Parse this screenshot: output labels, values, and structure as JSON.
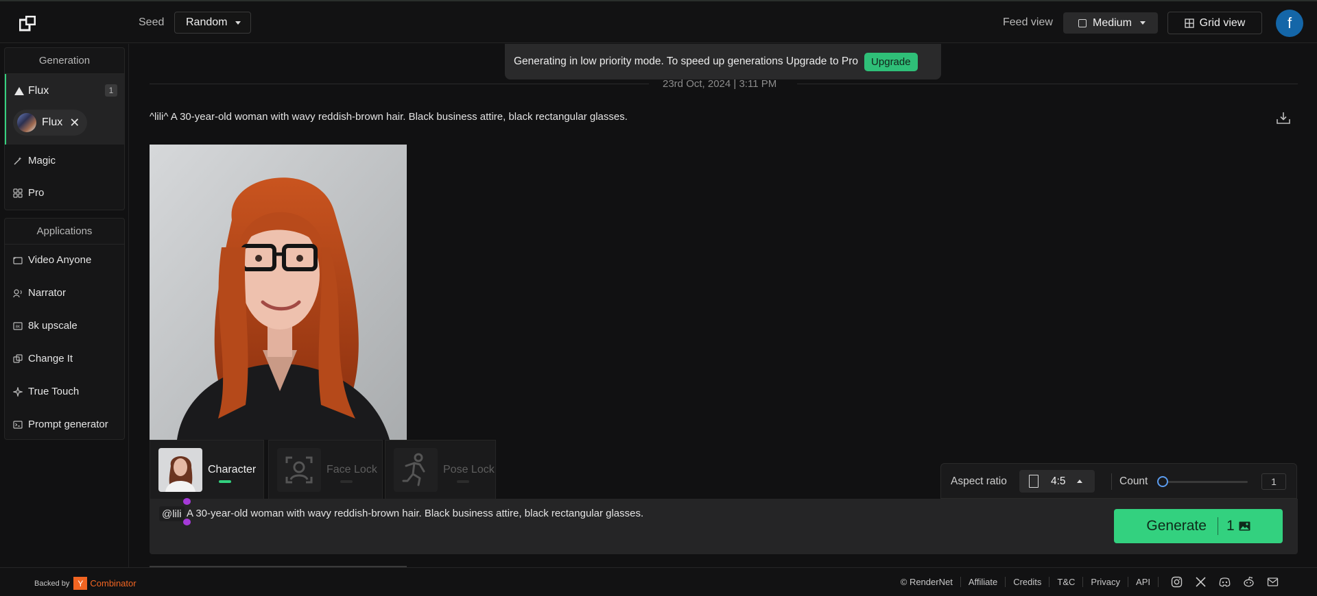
{
  "topbar": {
    "seed_label": "Seed",
    "seed_value": "Random",
    "feed_label": "Feed view",
    "feed_value": "Medium",
    "grid_label": "Grid view",
    "avatar_letter": "f"
  },
  "sidebar": {
    "generation_title": "Generation",
    "flux_label": "Flux",
    "flux_badge": "1",
    "flux_chip_label": "Flux",
    "magic_label": "Magic",
    "pro_label": "Pro",
    "applications_title": "Applications",
    "apps": [
      {
        "label": "Video Anyone",
        "icon": "video-icon"
      },
      {
        "label": "Narrator",
        "icon": "narrator-icon"
      },
      {
        "label": "8k upscale",
        "icon": "upscale-icon"
      },
      {
        "label": "Change It",
        "icon": "change-icon"
      },
      {
        "label": "True Touch",
        "icon": "sparkle-icon"
      },
      {
        "label": "Prompt generator",
        "icon": "terminal-icon"
      }
    ]
  },
  "banner": {
    "message": "Generating in low priority mode. To speed up generations Upgrade to Pro",
    "upgrade_label": "Upgrade"
  },
  "feed": {
    "date": "23rd Oct, 2024 | 3:11 PM",
    "prompt": "^lili^ A 30-year-old woman with wavy reddish-brown hair. Black business attire, black rectangular glasses."
  },
  "tools": {
    "character_label": "Character",
    "face_lock_label": "Face Lock",
    "pose_lock_label": "Pose Lock"
  },
  "options": {
    "aspect_label": "Aspect ratio",
    "aspect_value": "4:5",
    "count_label": "Count",
    "count_value": "1",
    "count_slider_fraction": 0
  },
  "prompt_input": {
    "mention": "@lili",
    "text": "A 30-year-old woman with wavy reddish-brown hair. Black business attire, black rectangular glasses."
  },
  "generate": {
    "label": "Generate",
    "count": "1"
  },
  "footer": {
    "backed_by": "Backed by",
    "yc_letter": "Y",
    "combinator": "Combinator",
    "links": [
      "© RenderNet",
      "Affiliate",
      "Credits",
      "T&C",
      "Privacy",
      "API"
    ]
  },
  "colors": {
    "accent": "#33d17f",
    "brand_avatar": "#1466a8",
    "yc_orange": "#f26522"
  }
}
